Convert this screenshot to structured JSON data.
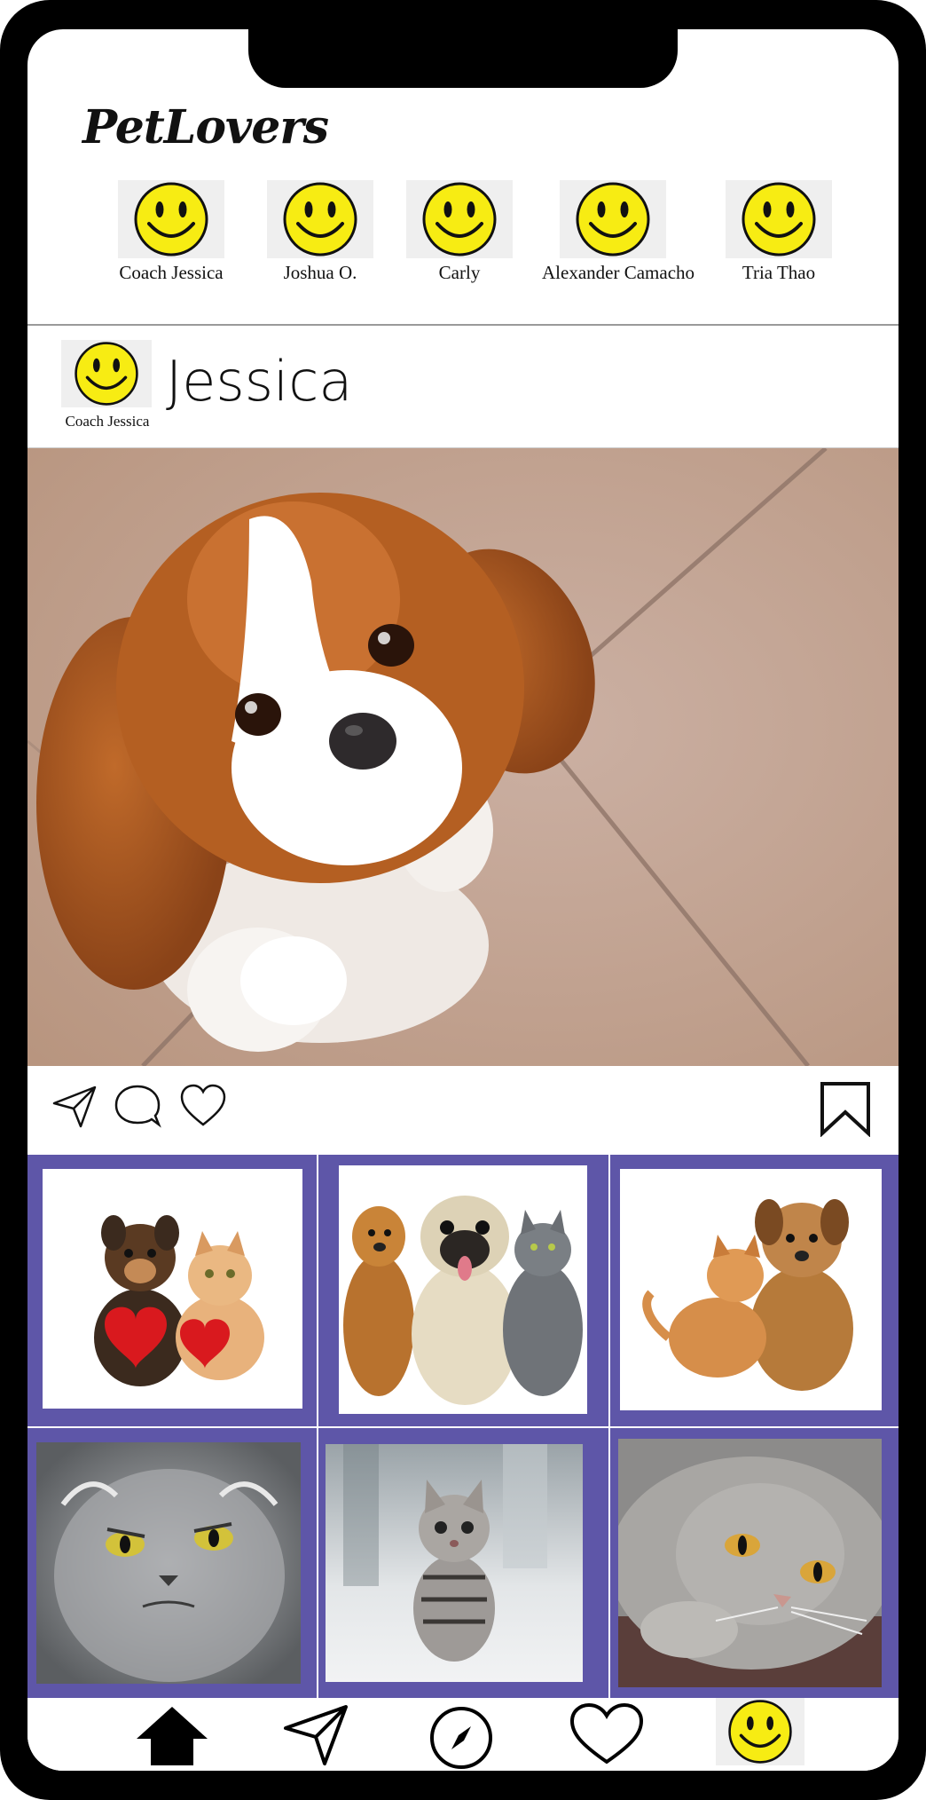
{
  "app": {
    "logo": "PetLovers"
  },
  "stories": [
    {
      "name": "Coach Jessica",
      "avatar": "smiley-face-icon"
    },
    {
      "name": "Joshua O.",
      "avatar": "smiley-face-icon"
    },
    {
      "name": "Carly",
      "avatar": "smiley-face-icon"
    },
    {
      "name": "Alexander Camacho",
      "avatar": "smiley-face-icon"
    },
    {
      "name": "Tria Thao",
      "avatar": "smiley-face-icon"
    }
  ],
  "post": {
    "author_caption": "Coach Jessica",
    "author_name": "Jessica",
    "photo": "dog-photo"
  },
  "actions": {
    "left": [
      "send-icon",
      "comment-icon",
      "heart-icon"
    ],
    "right": "bookmark-icon"
  },
  "grid": {
    "items": [
      "puppy-kitten-hearts-photo",
      "dogs-and-cat-photo",
      "kitten-puppy-photo",
      "grumpy-persian-cat-photo",
      "tabby-kitten-photo",
      "scottish-fold-cat-photo"
    ]
  },
  "bottom_nav": [
    "home-icon",
    "send-icon",
    "compass-icon",
    "heart-icon",
    "profile-smiley-icon"
  ],
  "colors": {
    "accent": "#5e56a8",
    "smiley": "#f7ec13",
    "frame": "#000000"
  }
}
